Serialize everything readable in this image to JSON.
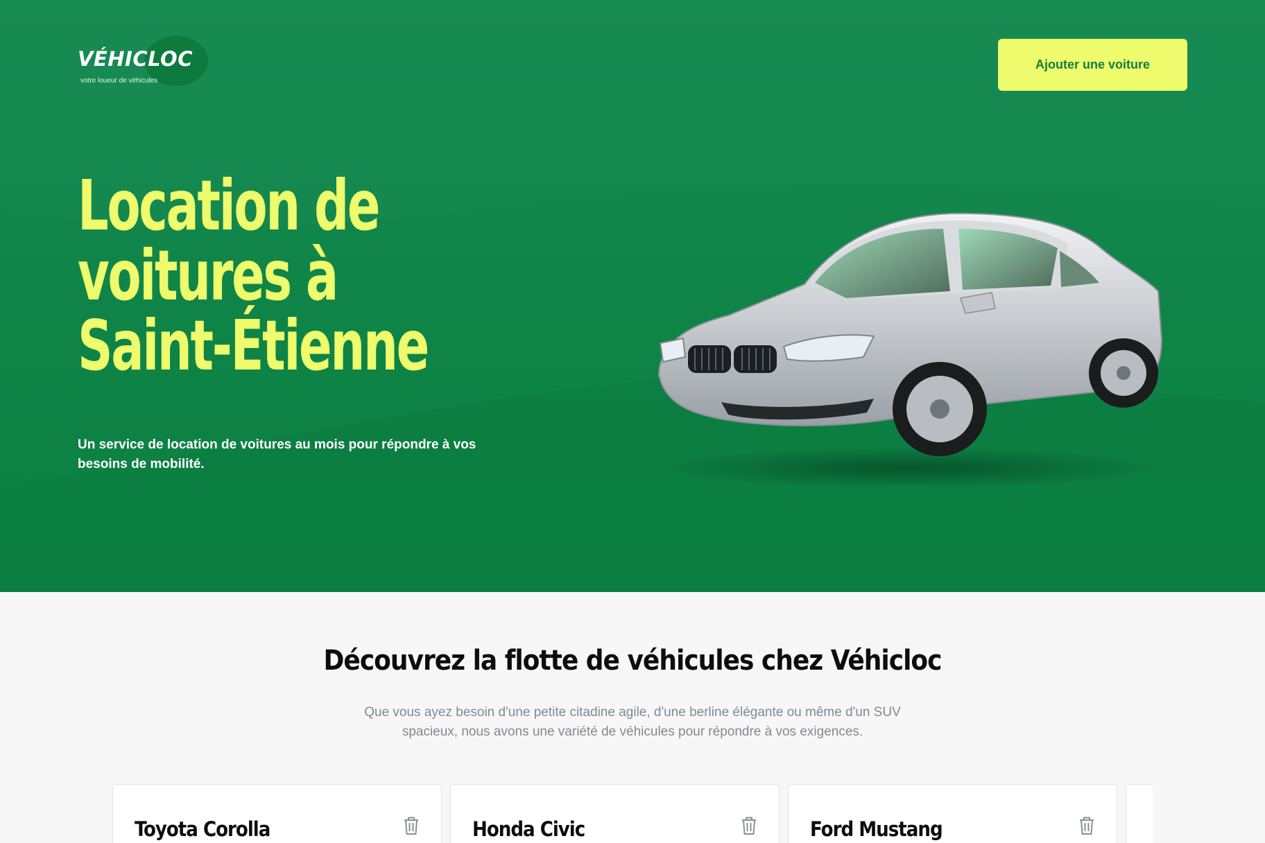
{
  "brand": {
    "name": "VÉHICLOC",
    "tagline": "votre loueur de véhicules",
    "primary_color": "#0f8447",
    "accent_color": "#eefb6c"
  },
  "header": {
    "add_car_label": "Ajouter une voiture"
  },
  "hero": {
    "title": "Location de voitures à Saint-Étienne",
    "subtitle": "Un service de location de voitures au mois pour répondre à vos besoins de mobilité.",
    "image_icon": "silver-sedan-car"
  },
  "fleet": {
    "title": "Découvrez la flotte de véhicules chez Véhicloc",
    "description": "Que vous ayez besoin d'une petite citadine agile, d'une berline élégante ou même d'un SUV spacieux, nous avons une variété de véhicules pour répondre à vos exigences.",
    "cards": [
      {
        "name": "Toyota Corolla",
        "action_icon": "trash-icon"
      },
      {
        "name": "Honda Civic",
        "action_icon": "trash-icon"
      },
      {
        "name": "Ford Mustang",
        "action_icon": "trash-icon"
      }
    ]
  }
}
